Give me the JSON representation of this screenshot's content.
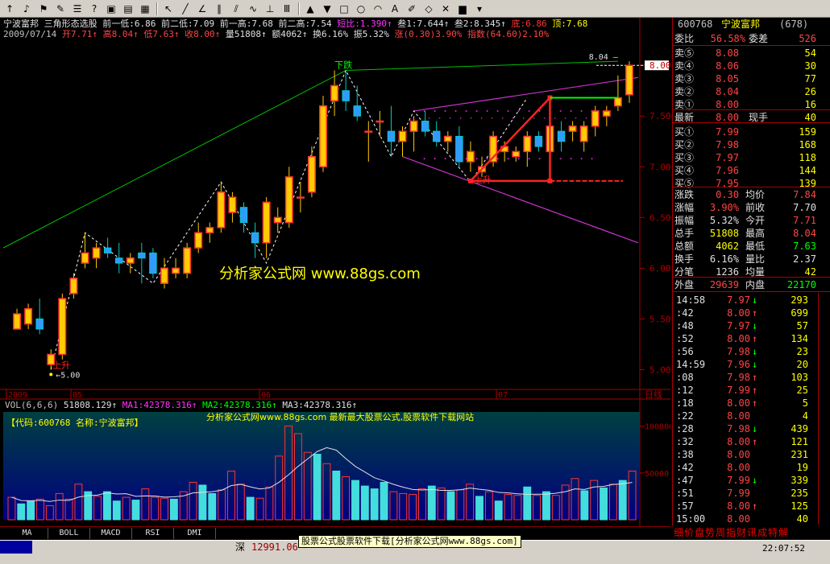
{
  "toolbar": {
    "icons": [
      "up-arrow-icon",
      "bell-icon",
      "alarm-icon",
      "pencil-icon",
      "list-icon",
      "help-icon",
      "image-icon",
      "chart-icon",
      "grid-icon",
      "cursor-icon",
      "line-icon",
      "fan-icon",
      "parallel-icon",
      "channel-icon",
      "wave-icon",
      "cycle-icon",
      "text-icon",
      "up-icon",
      "down-icon",
      "rect-icon",
      "ellipse-icon",
      "arc-icon",
      "text-tool-icon",
      "brush-icon",
      "eraser-icon",
      "delete-icon",
      "save-icon",
      "dropdown-icon"
    ]
  },
  "header": {
    "line1": [
      {
        "t": "宁波富邦",
        "c": "#e0e0e0"
      },
      {
        "t": "三角形态选股",
        "c": "#e0e0e0"
      },
      {
        "t": "前一低:6.86",
        "c": "#e0e0e0"
      },
      {
        "t": "前二低:7.09",
        "c": "#e0e0e0"
      },
      {
        "t": "前一高:7.68",
        "c": "#e0e0e0"
      },
      {
        "t": "前二高:7.54",
        "c": "#e0e0e0"
      },
      {
        "t": "短比:1.390↑",
        "c": "#ff33ff"
      },
      {
        "t": "叁1:7.644↑",
        "c": "#e0e0e0"
      },
      {
        "t": "叁2:8.345↑",
        "c": "#e0e0e0"
      },
      {
        "t": "底:6.86",
        "c": "#ff3333"
      },
      {
        "t": "顶:7.68",
        "c": "#ffff00"
      }
    ],
    "line2": [
      {
        "t": "2009/07/14",
        "c": "#c0c0c0"
      },
      {
        "t": "开7.71↑",
        "c": "#ff4444"
      },
      {
        "t": "高8.04↑",
        "c": "#ff4444"
      },
      {
        "t": "低7.63↑",
        "c": "#ff4444"
      },
      {
        "t": "收8.00↑",
        "c": "#ff4444"
      },
      {
        "t": "量51808↑",
        "c": "#e0e0e0"
      },
      {
        "t": "额4062↑",
        "c": "#e0e0e0"
      },
      {
        "t": "换6.16%",
        "c": "#e0e0e0"
      },
      {
        "t": "振5.32%",
        "c": "#e0e0e0"
      },
      {
        "t": "涨(0.30)3.90%",
        "c": "#ff4444"
      },
      {
        "t": "指数(64.60)2.10%",
        "c": "#ff4444"
      }
    ]
  },
  "price_axis": {
    "ticks": [
      "8.00",
      "7.50",
      "7.00",
      "6.50",
      "6.00",
      "5.50",
      "5.00"
    ],
    "current": "8.00"
  },
  "date_axis": {
    "labels": [
      {
        "t": "2009",
        "x": 8
      },
      {
        "t": "05",
        "x": 88
      },
      {
        "t": "06",
        "x": 322
      },
      {
        "t": "07",
        "x": 616
      }
    ],
    "suffix": "日线"
  },
  "chart_data": {
    "type": "candlestick",
    "ylim": [
      4.9,
      8.2
    ],
    "candles": [
      [
        5.4,
        5.6,
        5.45,
        5.55
      ],
      [
        5.45,
        5.65,
        5.4,
        5.6
      ],
      [
        5.5,
        5.7,
        5.35,
        5.4
      ],
      [
        5.05,
        5.2,
        5.0,
        5.15
      ],
      [
        5.15,
        5.75,
        5.1,
        5.7
      ],
      [
        5.75,
        5.95,
        5.7,
        5.9
      ],
      [
        6.05,
        6.35,
        6.0,
        6.15
      ],
      [
        6.1,
        6.25,
        6.0,
        6.2
      ],
      [
        6.2,
        6.3,
        6.1,
        6.15
      ],
      [
        6.1,
        6.25,
        5.95,
        6.05
      ],
      [
        6.05,
        6.15,
        5.95,
        6.1
      ],
      [
        6.15,
        6.25,
        5.85,
        6.1
      ],
      [
        6.15,
        6.2,
        5.9,
        5.95
      ],
      [
        5.85,
        6.1,
        5.8,
        6.0
      ],
      [
        5.95,
        6.1,
        5.9,
        6.0
      ],
      [
        5.95,
        6.25,
        5.9,
        6.2
      ],
      [
        6.2,
        6.45,
        6.15,
        6.35
      ],
      [
        6.35,
        6.45,
        6.25,
        6.4
      ],
      [
        6.4,
        6.85,
        6.35,
        6.75
      ],
      [
        6.55,
        6.75,
        6.45,
        6.7
      ],
      [
        6.6,
        6.65,
        6.35,
        6.45
      ],
      [
        6.35,
        6.45,
        6.1,
        6.25
      ],
      [
        6.25,
        6.7,
        6.1,
        6.65
      ],
      [
        6.45,
        6.6,
        6.35,
        6.5
      ],
      [
        6.45,
        7.0,
        6.4,
        6.9
      ],
      [
        6.7,
        6.85,
        6.55,
        6.7
      ],
      [
        6.75,
        7.2,
        6.7,
        7.1
      ],
      [
        7.0,
        7.7,
        6.95,
        7.6
      ],
      [
        7.65,
        7.95,
        7.5,
        7.8
      ],
      [
        7.75,
        7.95,
        7.55,
        7.65
      ],
      [
        7.6,
        7.8,
        7.45,
        7.5
      ],
      [
        7.35,
        7.45,
        7.05,
        7.35
      ],
      [
        7.45,
        7.55,
        7.3,
        7.45
      ],
      [
        7.35,
        7.6,
        7.1,
        7.25
      ],
      [
        7.25,
        7.4,
        7.1,
        7.35
      ],
      [
        7.35,
        7.5,
        7.15,
        7.45
      ],
      [
        7.45,
        7.55,
        7.3,
        7.35
      ],
      [
        7.35,
        7.45,
        7.2,
        7.25
      ],
      [
        7.25,
        7.35,
        7.15,
        7.3
      ],
      [
        7.3,
        7.4,
        7.0,
        7.05
      ],
      [
        7.05,
        7.25,
        6.95,
        7.15
      ],
      [
        6.95,
        7.1,
        6.9,
        7.0
      ],
      [
        7.05,
        7.35,
        7.0,
        7.3
      ],
      [
        7.15,
        7.25,
        7.05,
        7.2
      ],
      [
        7.1,
        7.2,
        7.05,
        7.15
      ],
      [
        7.15,
        7.35,
        7.0,
        7.3
      ],
      [
        7.3,
        7.35,
        7.15,
        7.2
      ],
      [
        7.15,
        7.55,
        7.05,
        7.4
      ],
      [
        7.35,
        7.45,
        7.15,
        7.25
      ],
      [
        7.35,
        7.45,
        7.25,
        7.4
      ],
      [
        7.25,
        7.45,
        7.15,
        7.4
      ],
      [
        7.4,
        7.6,
        7.3,
        7.55
      ],
      [
        7.5,
        7.6,
        7.4,
        7.55
      ],
      [
        7.6,
        7.9,
        7.55,
        7.68
      ],
      [
        7.71,
        8.04,
        7.63,
        8.0
      ]
    ],
    "drawn_label_fall": "下跌",
    "drawn_label_rise": "上升",
    "hi_label": "8.04",
    "lo_label": "5.00",
    "watermark": "分析家公式网 www.88gs.com"
  },
  "volume": {
    "legend": [
      {
        "t": "VOL(6,6,6)",
        "c": "#c0c0c0"
      },
      {
        "t": "51808.129↑",
        "c": "#e0e0e0"
      },
      {
        "t": "MA1:42378.316↑",
        "c": "#ff33ff"
      },
      {
        "t": "MA2:42378.316↑",
        "c": "#00ff00"
      },
      {
        "t": "MA3:42378.316↑",
        "c": "#e0e0e0"
      }
    ],
    "code_label": "【代码:600768 名称:宁波富邦】",
    "banner": "分析家公式网www.88gs.com 最新最大股票公式,股票软件下载网站",
    "ticks": [
      "100000",
      "50000"
    ],
    "bars": [
      24,
      17,
      20,
      22,
      15,
      28,
      22,
      38,
      30,
      25,
      30,
      20,
      24,
      21,
      33,
      24,
      23,
      22,
      30,
      40,
      37,
      28,
      32,
      52,
      38,
      24,
      23,
      35,
      68,
      100,
      92,
      72,
      70,
      60,
      52,
      46,
      42,
      36,
      33,
      40,
      30,
      28,
      27,
      33,
      36,
      34,
      30,
      32,
      38,
      25,
      30,
      20,
      27,
      26,
      35,
      26,
      30,
      26,
      37,
      44,
      31,
      42,
      34,
      38,
      42,
      52
    ],
    "up": [
      1,
      0,
      0,
      1,
      1,
      1,
      1,
      1,
      0,
      1,
      0,
      0,
      1,
      0,
      1,
      1,
      1,
      0,
      1,
      1,
      0,
      0,
      1,
      1,
      1,
      0,
      1,
      1,
      1,
      1,
      1,
      1,
      0,
      1,
      0,
      1,
      0,
      0,
      0,
      0,
      1,
      1,
      1,
      1,
      0,
      1,
      0,
      1,
      1,
      0,
      1,
      0,
      1,
      1,
      0,
      1,
      0,
      1,
      1,
      1,
      0,
      1,
      0,
      1,
      0,
      1
    ]
  },
  "tabs": [
    "MA",
    "BOLL",
    "MACD",
    "RSI",
    "DMI"
  ],
  "quote": {
    "code": "600768",
    "name": "宁波富邦",
    "num": "(678)",
    "wb_label": "委比",
    "wb_val": "56.58%",
    "wc_label": "委差",
    "wc_val": "526",
    "sell": [
      {
        "l": "卖⑤",
        "p": "8.08",
        "v": "54"
      },
      {
        "l": "卖④",
        "p": "8.06",
        "v": "30"
      },
      {
        "l": "卖③",
        "p": "8.05",
        "v": "77"
      },
      {
        "l": "卖②",
        "p": "8.04",
        "v": "26"
      },
      {
        "l": "卖①",
        "p": "8.00",
        "v": "16"
      }
    ],
    "last_label": "最新",
    "last": "8.00",
    "cur_label": "现手",
    "cur": "40",
    "buy": [
      {
        "l": "买①",
        "p": "7.99",
        "v": "159"
      },
      {
        "l": "买②",
        "p": "7.98",
        "v": "168"
      },
      {
        "l": "买③",
        "p": "7.97",
        "v": "118"
      },
      {
        "l": "买④",
        "p": "7.96",
        "v": "144"
      },
      {
        "l": "买⑤",
        "p": "7.95",
        "v": "139"
      }
    ],
    "stats": [
      {
        "a": "涨跌",
        "b": "0.30",
        "c": "均价",
        "d": "7.84",
        "bc": "#ff4444",
        "dc": "#ff4444"
      },
      {
        "a": "涨幅",
        "b": "3.90%",
        "c": "前收",
        "d": "7.70",
        "bc": "#ff4444",
        "dc": "#e0e0e0"
      },
      {
        "a": "振幅",
        "b": "5.32%",
        "c": "今开",
        "d": "7.71",
        "bc": "#e0e0e0",
        "dc": "#ff4444"
      },
      {
        "a": "总手",
        "b": "51808",
        "c": "最高",
        "d": "8.04",
        "bc": "#ffff00",
        "dc": "#ff4444"
      },
      {
        "a": "总额",
        "b": "4062",
        "c": "最低",
        "d": "7.63",
        "bc": "#ffff00",
        "dc": "#00ff00"
      },
      {
        "a": "换手",
        "b": "6.16%",
        "c": "量比",
        "d": "2.37",
        "bc": "#e0e0e0",
        "dc": "#e0e0e0"
      },
      {
        "a": "分笔",
        "b": "1236",
        "c": "均量",
        "d": "42",
        "bc": "#e0e0e0",
        "dc": "#ffff00"
      }
    ],
    "out_label": "外盘",
    "out": "29639",
    "in_label": "内盘",
    "in": "22170",
    "ticks": [
      {
        "t": "14:58",
        "p": "7.97",
        "a": "↓",
        "v": "293"
      },
      {
        "t": ":42",
        "p": "8.00",
        "a": "↑",
        "v": "699"
      },
      {
        "t": ":48",
        "p": "7.97",
        "a": "↓",
        "v": "57"
      },
      {
        "t": ":52",
        "p": "8.00",
        "a": "↑",
        "v": "134"
      },
      {
        "t": ":56",
        "p": "7.98",
        "a": "↓",
        "v": "23"
      },
      {
        "t": "14:59",
        "p": "7.96",
        "a": "↓",
        "v": "20"
      },
      {
        "t": ":08",
        "p": "7.98",
        "a": "↑",
        "v": "103"
      },
      {
        "t": ":12",
        "p": "7.99",
        "a": "↑",
        "v": "25"
      },
      {
        "t": ":18",
        "p": "8.00",
        "a": "↑",
        "v": "5"
      },
      {
        "t": ":22",
        "p": "8.00",
        "a": "",
        "v": "4"
      },
      {
        "t": ":28",
        "p": "7.98",
        "a": "↓",
        "v": "439"
      },
      {
        "t": ":32",
        "p": "8.00",
        "a": "↑",
        "v": "121"
      },
      {
        "t": ":38",
        "p": "8.00",
        "a": "",
        "v": "231"
      },
      {
        "t": ":42",
        "p": "8.00",
        "a": "",
        "v": "19"
      },
      {
        "t": ":47",
        "p": "7.99",
        "a": "↓",
        "v": "339"
      },
      {
        "t": ":51",
        "p": "7.99",
        "a": "",
        "v": "235"
      },
      {
        "t": ":57",
        "p": "8.00",
        "a": "↑",
        "v": "125"
      },
      {
        "t": "15:00",
        "p": "8.00",
        "a": "",
        "v": "40"
      }
    ],
    "bottom_tabs": "细价盘势周指财讯成特解"
  },
  "status": {
    "market": "深",
    "index": "12991.06",
    "ad": "股票公式股票软件下载[分析家公式网www.88gs.com]",
    "time": "22:07:52"
  }
}
